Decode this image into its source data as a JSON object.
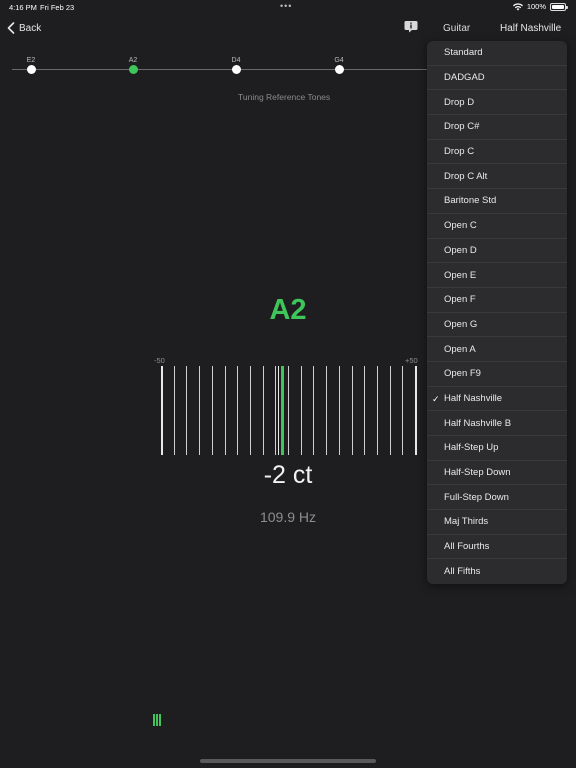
{
  "status_bar": {
    "time": "4:16 PM",
    "date": "Fri Feb 23",
    "dots": "•••",
    "battery": "100%"
  },
  "nav": {
    "back_label": "Back",
    "instrument": "Guitar",
    "tuning": "Half Nashville"
  },
  "strings": [
    {
      "label": "E2",
      "active": false
    },
    {
      "label": "A2",
      "active": true
    },
    {
      "label": "D4",
      "active": false
    },
    {
      "label": "G4",
      "active": false
    }
  ],
  "reference_tones_label": "Tuning Reference Tones",
  "note": "A2",
  "meter": {
    "min_label": "-50",
    "max_label": "+50",
    "cents_value": -2
  },
  "cents_text": "-2 ct",
  "frequency_text": "109.9 Hz",
  "tunings": [
    "Standard",
    "DADGAD",
    "Drop D",
    "Drop C#",
    "Drop C",
    "Drop C Alt",
    "Baritone Std",
    "Open C",
    "Open D",
    "Open E",
    "Open F",
    "Open G",
    "Open A",
    "Open F9",
    "Half Nashville",
    "Half Nashville B",
    "Half-Step Up",
    "Half-Step Down",
    "Full-Step Down",
    "Maj Thirds",
    "All Fourths",
    "All Fifths"
  ],
  "selected_tuning": "Half Nashville",
  "colors": {
    "accent": "#3ec65a",
    "background": "#1e1e20",
    "menu_background": "#2c2c2e"
  }
}
